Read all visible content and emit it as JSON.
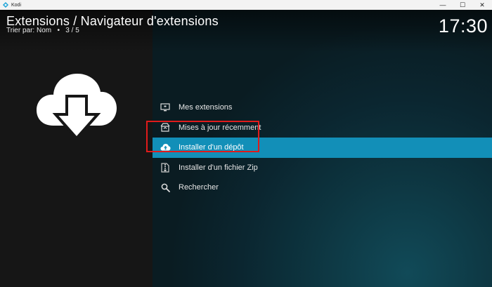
{
  "window": {
    "app_name": "Kodi",
    "controls": {
      "minimize": "—",
      "maximize": "☐",
      "close": "✕"
    }
  },
  "header": {
    "title": "Extensions / Navigateur d'extensions",
    "sort": "Trier par: Nom",
    "separator": "•",
    "position": "3 / 5"
  },
  "clock": "17:30",
  "main_icon": "cloud-download-icon",
  "menu": {
    "items": [
      {
        "label": "Mes extensions",
        "icon": "monitor-icon"
      },
      {
        "label": "Mises à jour récemment",
        "icon": "box-update-icon"
      },
      {
        "label": "Installer d'un dépôt",
        "icon": "cloud-upload-icon",
        "focused": true
      },
      {
        "label": "Installer d'un fichier Zip",
        "icon": "zip-file-icon"
      },
      {
        "label": "Rechercher",
        "icon": "search-icon"
      }
    ]
  },
  "colors": {
    "focus": "#128fb8",
    "annotation": "#e01b1b",
    "left_panel": "#161616"
  }
}
